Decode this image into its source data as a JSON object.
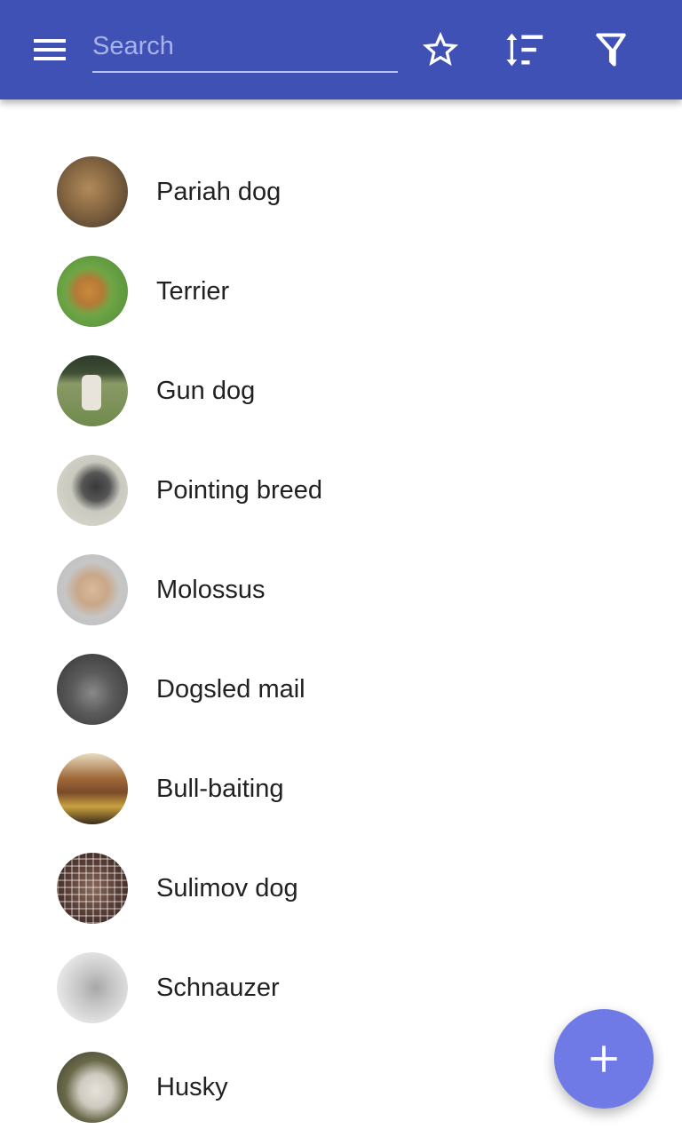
{
  "appbar": {
    "background": "#3f51b5",
    "menu_icon": "hamburger-menu-icon",
    "search": {
      "value": "",
      "placeholder": "Search"
    },
    "actions": [
      {
        "name": "favorites",
        "icon": "star-outline-icon"
      },
      {
        "name": "sort",
        "icon": "sort-icon"
      },
      {
        "name": "filter",
        "icon": "filter-icon"
      }
    ]
  },
  "list": {
    "items": [
      {
        "label": "Pariah dog",
        "image": "dog-thumbnail"
      },
      {
        "label": "Terrier",
        "image": "dog-thumbnail"
      },
      {
        "label": "Gun dog",
        "image": "dog-thumbnail"
      },
      {
        "label": "Pointing breed",
        "image": "dog-thumbnail"
      },
      {
        "label": "Molossus",
        "image": "dog-thumbnail"
      },
      {
        "label": "Dogsled mail",
        "image": "dog-thumbnail"
      },
      {
        "label": "Bull-baiting",
        "image": "dog-thumbnail"
      },
      {
        "label": "Sulimov dog",
        "image": "dog-thumbnail"
      },
      {
        "label": "Schnauzer",
        "image": "dog-thumbnail"
      },
      {
        "label": "Husky",
        "image": "dog-thumbnail"
      }
    ]
  },
  "fab": {
    "icon": "plus-icon",
    "color": "#6f7ae6"
  }
}
